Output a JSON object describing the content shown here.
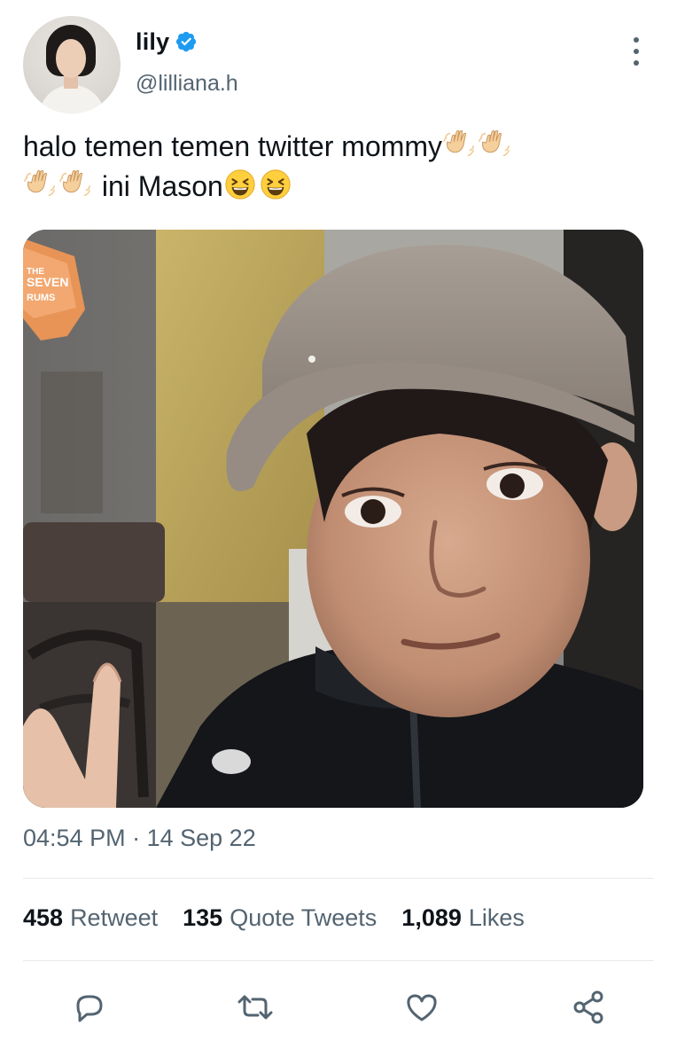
{
  "user": {
    "name": "lily",
    "handle": "@lilliana.h",
    "verified": true
  },
  "tweet": {
    "text_line1": "halo temen temen twitter mommy",
    "text_line2": "ini Mason",
    "emoji_line1": [
      "waving-hand-icon",
      "waving-hand-icon"
    ],
    "emoji_line2_lead": [
      "waving-hand-icon",
      "waving-hand-icon"
    ],
    "emoji_line2_tail": [
      "grinning-squinting-face-icon",
      "grinning-squinting-face-icon"
    ],
    "image_sign_text": [
      "THE",
      "SEVEN",
      "RUMS"
    ]
  },
  "meta": {
    "time": "04:54 PM",
    "separator": "·",
    "date": "14 Sep 22"
  },
  "stats": {
    "retweets_count": "458",
    "retweets_label": "Retweet",
    "quotes_count": "135",
    "quotes_label": "Quote Tweets",
    "likes_count": "1,089",
    "likes_label": "Likes"
  },
  "actions": [
    "reply-icon",
    "retweet-icon",
    "like-icon",
    "share-icon"
  ],
  "colors": {
    "accent": "#1d9bf0",
    "text": "#0f1419",
    "secondary": "#536471",
    "divider": "#e6e9eb"
  }
}
